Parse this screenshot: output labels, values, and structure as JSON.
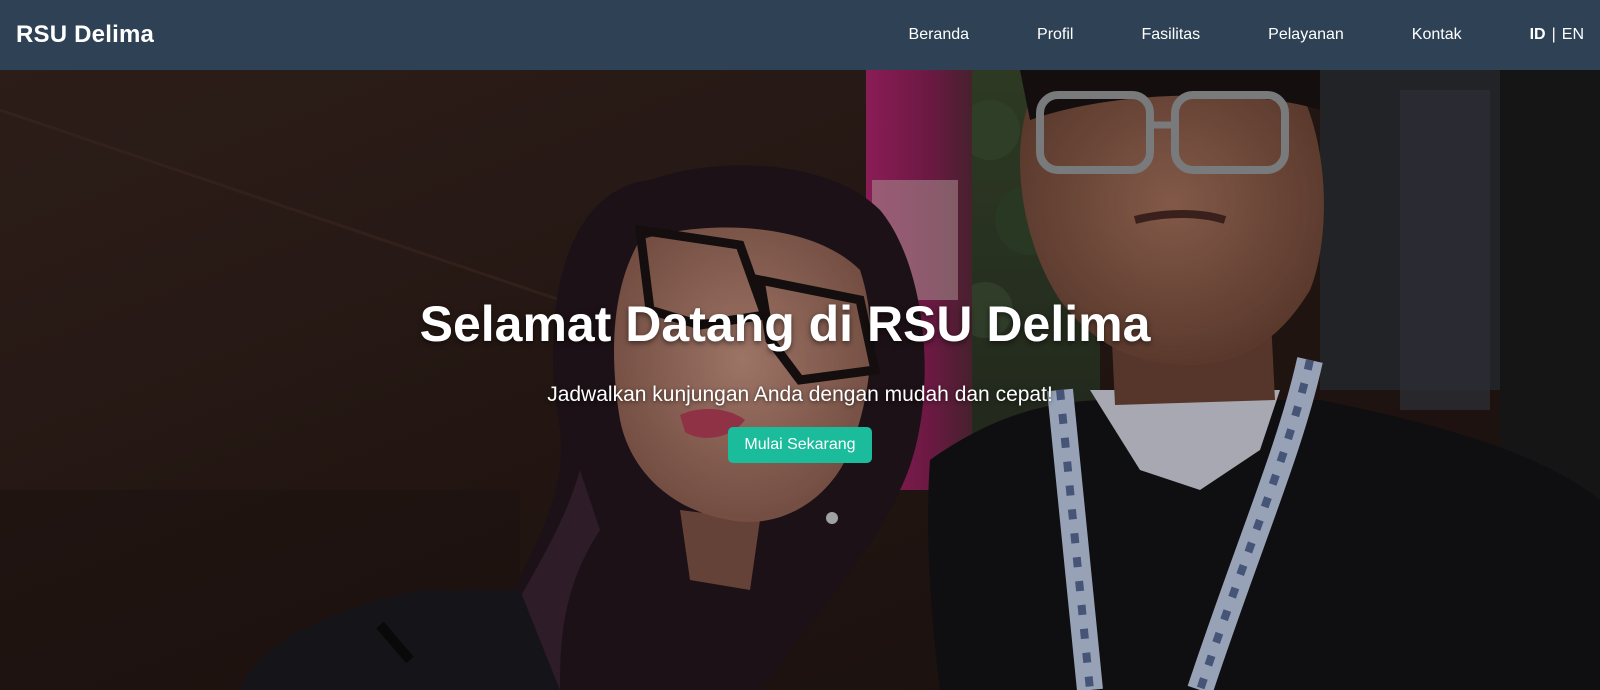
{
  "navbar": {
    "brand": "RSU Delima",
    "links": [
      "Beranda",
      "Profil",
      "Fasilitas",
      "Pelayanan",
      "Kontak"
    ],
    "lang": {
      "id": "ID",
      "separator": "|",
      "en": "EN"
    }
  },
  "hero": {
    "title": "Selamat Datang di RSU Delima",
    "subtitle": "Jadwalkan kunjungan Anda dengan mudah dan cepat!",
    "cta_label": "Mulai Sekarang"
  },
  "colors": {
    "navbar_bg": "#2e4155",
    "cta_bg": "#1abc9c",
    "text": "#ffffff"
  }
}
